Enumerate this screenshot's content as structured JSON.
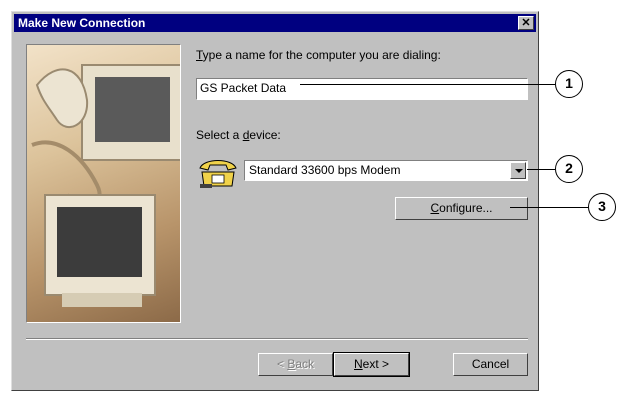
{
  "window": {
    "title": "Make New Connection",
    "close_symbol": "✕"
  },
  "form": {
    "name_label_prefix": "",
    "name_label_accel": "T",
    "name_label_rest": "ype a name for the computer you are dialing:",
    "name_value": "GS Packet Data",
    "device_label_prefix": "Select a ",
    "device_label_accel": "d",
    "device_label_rest": "evice:",
    "device_value": "Standard 33600 bps Modem",
    "configure_accel": "C",
    "configure_rest": "onfigure..."
  },
  "buttons": {
    "back_prefix": "< ",
    "back_accel": "B",
    "back_rest": "ack",
    "next_accel": "N",
    "next_rest": "ext >",
    "cancel": "Cancel"
  },
  "callouts": [
    "1",
    "2",
    "3"
  ],
  "icons": {
    "device": "telephone-modem-icon",
    "close": "close-icon",
    "dropdown": "chevron-down-icon"
  },
  "colors": {
    "titlebar": "#000080",
    "dialog_bg": "#c0c0c0"
  }
}
